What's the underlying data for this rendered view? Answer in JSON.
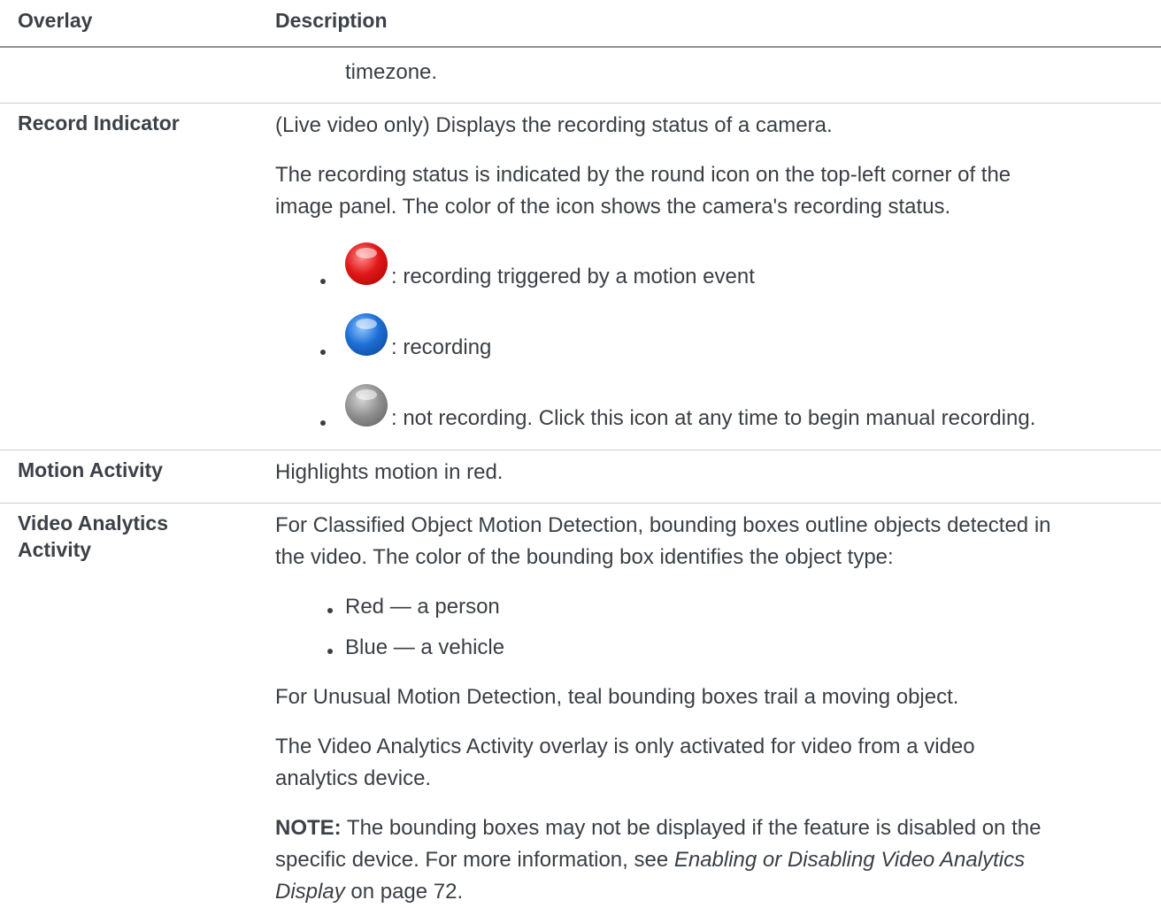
{
  "table": {
    "header": {
      "col1": "Overlay",
      "col2": "Description"
    },
    "timezone_tail": "timezone.",
    "record_indicator": {
      "name": "Record Indicator",
      "para1": "(Live video only) Displays the recording status of a camera.",
      "para2_line1": "The recording status is indicated by the round icon on the top-left corner of the",
      "para2_line2": "image panel. The color of the icon shows the camera's recording status.",
      "bullets": [
        {
          "icon": "red-record-icon",
          "color": "#e01818",
          "text": ": recording triggered by a motion event"
        },
        {
          "icon": "blue-record-icon",
          "color": "#1d6fd6",
          "text": ": recording"
        },
        {
          "icon": "gray-record-icon",
          "color": "#8c8c8c",
          "text": ": not recording. Click this icon at any time to begin manual recording."
        }
      ]
    },
    "motion_activity": {
      "name": "Motion Activity",
      "desc": "Highlights motion in red."
    },
    "video_analytics": {
      "name_line1": "Video Analytics",
      "name_line2": "Activity",
      "para1_line1": "For Classified Object Motion Detection, bounding boxes outline objects detected in",
      "para1_line2": "the video. The color of the bounding box identifies the object type:",
      "bullets": [
        "Red — a person",
        "Blue — a vehicle"
      ],
      "para2": "For Unusual Motion Detection, teal bounding boxes trail a moving object.",
      "para3_line1": "The Video Analytics Activity overlay is only activated for video from a video",
      "para3_line2": "analytics device.",
      "note_label": "NOTE:",
      "note_line1": " The bounding boxes may not be displayed if the feature is disabled on the",
      "note_line2_pre": "specific device. For more information, see ",
      "note_link_part1": "Enabling or Disabling Video Analytics",
      "note_link_part2": "Display",
      "note_tail": " on page 72."
    }
  }
}
